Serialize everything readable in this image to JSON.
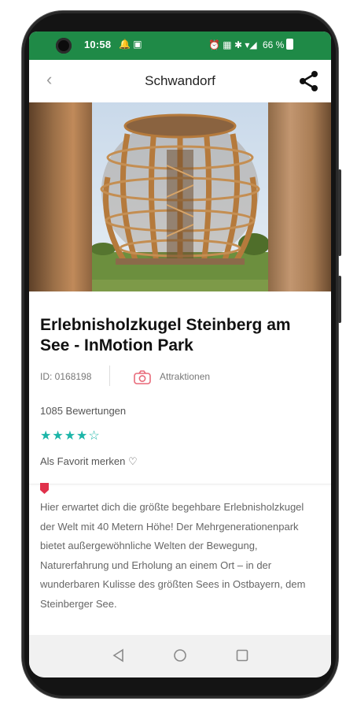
{
  "status_bar": {
    "time": "10:58",
    "left_icons": "🔔 ▣",
    "right_icons": "⏰ ▦ ✱ ▾◢",
    "battery": "66 %",
    "color": "#1f8a47"
  },
  "header": {
    "back_icon": "chevron-left-icon",
    "title": "Schwandorf",
    "share_icon": "share-icon"
  },
  "place": {
    "name": "Erlebnisholzkugel Steinberg am See - InMotion Park",
    "id_text": "ID: 0168198",
    "category_icon": "camera-icon",
    "category": "Attraktionen",
    "reviews": "1085 Bewertungen",
    "rating": 4,
    "rating_max": 5,
    "stars": "★★★★☆",
    "favorite": "Als Favorit merken ♡",
    "description": "Hier erwartet dich die größte begehbare Erlebnisholzkugel der Welt mit 40 Metern Höhe! Der Mehrgenerationenpark bietet außergewöhnliche Welten der Bewegung, Naturerfahrung und Erholung an einem Ort – in der wunderbaren Kulisse des größten Sees in Ostbayern, dem Steinberger See."
  },
  "colors": {
    "accent": "#1bb5a8",
    "marker": "#e0314b",
    "category_icon": "#e86a7a"
  },
  "navigation": {
    "back": "triangle-back-icon",
    "home": "circle-home-icon",
    "recents": "square-recents-icon"
  }
}
